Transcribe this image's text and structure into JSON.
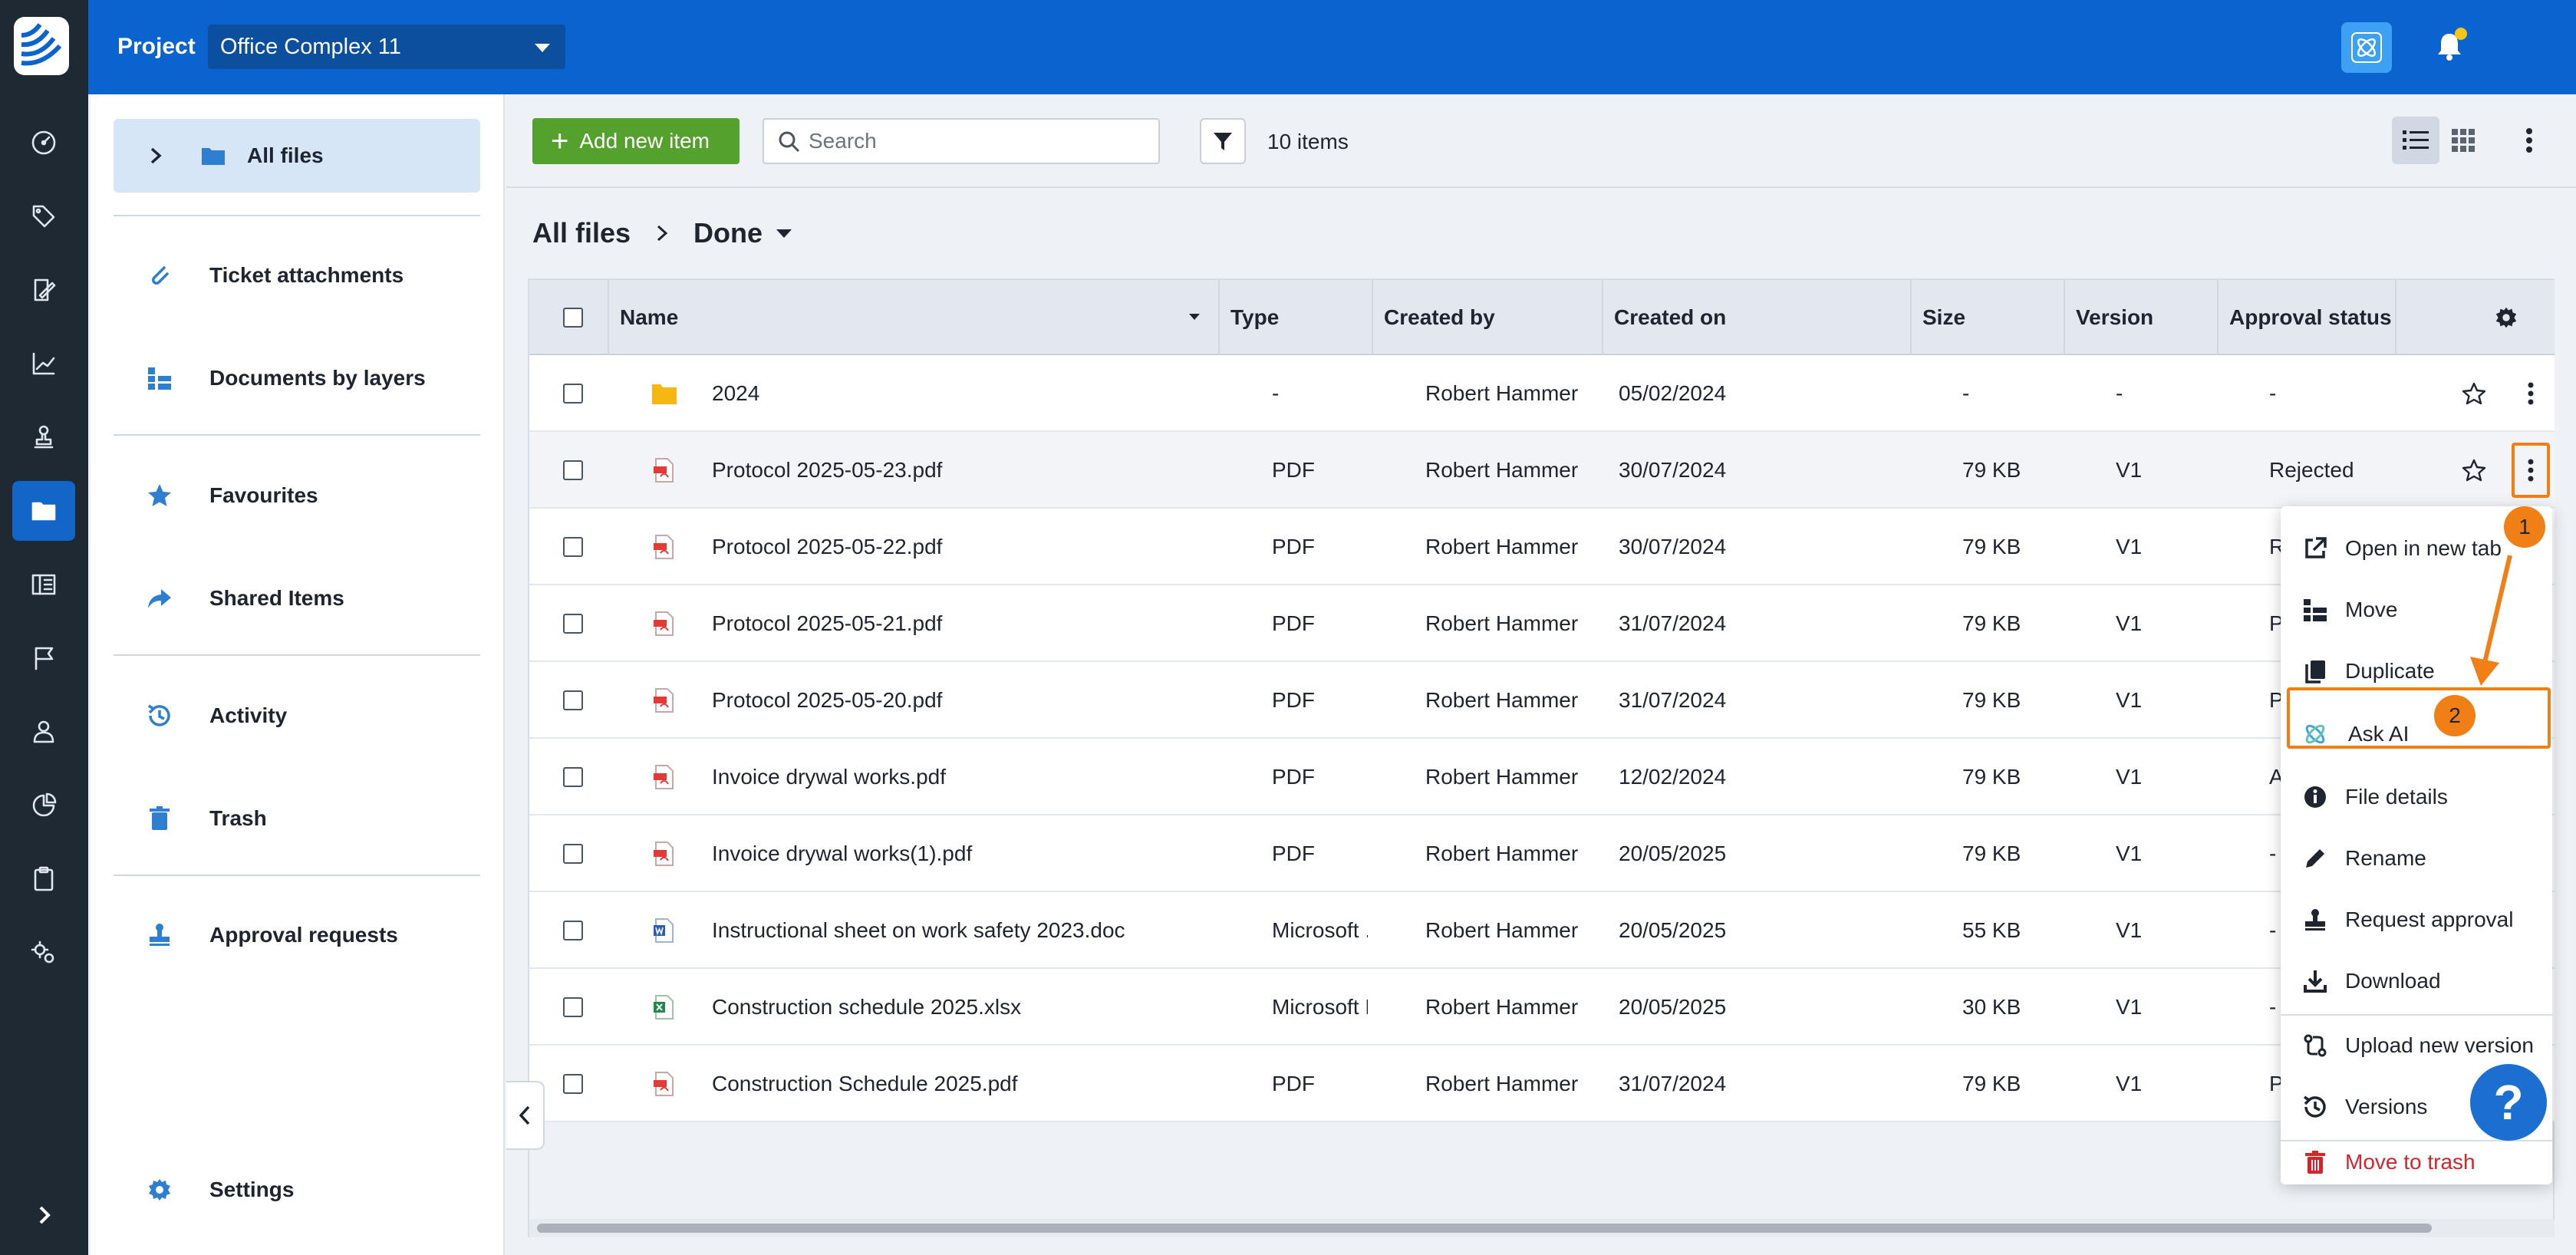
{
  "topbar": {
    "project_label": "Project",
    "project_value": "Office Complex 11"
  },
  "sidebar": {
    "items": [
      {
        "label": "All files",
        "icon": "folder-icon"
      },
      {
        "label": "Ticket attachments",
        "icon": "paperclip-icon"
      },
      {
        "label": "Documents by layers",
        "icon": "layers-icon"
      },
      {
        "label": "Favourites",
        "icon": "star-icon"
      },
      {
        "label": "Shared Items",
        "icon": "share-icon"
      },
      {
        "label": "Activity",
        "icon": "history-icon"
      },
      {
        "label": "Trash",
        "icon": "trash-icon"
      },
      {
        "label": "Approval requests",
        "icon": "stamp-icon"
      },
      {
        "label": "Settings",
        "icon": "gear-icon"
      }
    ]
  },
  "toolbar": {
    "add_label": "Add new item",
    "search_placeholder": "Search",
    "items_count": "10 items"
  },
  "breadcrumb": {
    "root": "All files",
    "current": "Done"
  },
  "table": {
    "columns": [
      "Name",
      "Type",
      "Created by",
      "Created on",
      "Size",
      "Version",
      "Approval status"
    ],
    "rows": [
      {
        "name": "2024",
        "type": "-",
        "created_by": "Robert Hammer",
        "created_on": "05/02/2024",
        "size": "-",
        "version": "-",
        "status": "-",
        "icon": "folder"
      },
      {
        "name": "Protocol 2025-05-23.pdf",
        "type": "PDF",
        "created_by": "Robert Hammer",
        "created_on": "30/07/2024",
        "size": "79 KB",
        "version": "V1",
        "status": "Rejected",
        "icon": "pdf"
      },
      {
        "name": "Protocol 2025-05-22.pdf",
        "type": "PDF",
        "created_by": "Robert Hammer",
        "created_on": "30/07/2024",
        "size": "79 KB",
        "version": "V1",
        "status": "Reje",
        "icon": "pdf"
      },
      {
        "name": "Protocol 2025-05-21.pdf",
        "type": "PDF",
        "created_by": "Robert Hammer",
        "created_on": "31/07/2024",
        "size": "79 KB",
        "version": "V1",
        "status": "Pen",
        "icon": "pdf"
      },
      {
        "name": "Protocol 2025-05-20.pdf",
        "type": "PDF",
        "created_by": "Robert Hammer",
        "created_on": "31/07/2024",
        "size": "79 KB",
        "version": "V1",
        "status": "Pen",
        "icon": "pdf"
      },
      {
        "name": "Invoice drywal works.pdf",
        "type": "PDF",
        "created_by": "Robert Hammer",
        "created_on": "12/02/2024",
        "size": "79 KB",
        "version": "V1",
        "status": "App",
        "icon": "pdf"
      },
      {
        "name": "Invoice drywal works(1).pdf",
        "type": "PDF",
        "created_by": "Robert Hammer",
        "created_on": "20/05/2025",
        "size": "79 KB",
        "version": "V1",
        "status": "-",
        "icon": "pdf"
      },
      {
        "name": "Instructional sheet on work safety 2023.doc",
        "type": "Microsoft ...",
        "created_by": "Robert Hammer",
        "created_on": "20/05/2025",
        "size": "55 KB",
        "version": "V1",
        "status": "-",
        "icon": "word"
      },
      {
        "name": "Construction schedule 2025.xlsx",
        "type": "Microsoft E...",
        "created_by": "Robert Hammer",
        "created_on": "20/05/2025",
        "size": "30 KB",
        "version": "V1",
        "status": "-",
        "icon": "excel"
      },
      {
        "name": "Construction Schedule 2025.pdf",
        "type": "PDF",
        "created_by": "Robert Hammer",
        "created_on": "31/07/2024",
        "size": "79 KB",
        "version": "V1",
        "status": "Pen",
        "icon": "pdf"
      }
    ]
  },
  "context_menu": {
    "items": [
      {
        "label": "Open in new tab",
        "icon": "external-link-icon"
      },
      {
        "label": "Move",
        "icon": "move-icon"
      },
      {
        "label": "Duplicate",
        "icon": "duplicate-icon"
      },
      {
        "label": "Ask AI",
        "icon": "ai-icon"
      },
      {
        "label": "File details",
        "icon": "info-icon"
      },
      {
        "label": "Rename",
        "icon": "pencil-icon"
      },
      {
        "label": "Request approval",
        "icon": "stamp-icon"
      },
      {
        "label": "Download",
        "icon": "download-icon"
      },
      {
        "label": "Upload new version",
        "icon": "upload-version-icon"
      },
      {
        "label": "Versions",
        "icon": "history-icon"
      },
      {
        "label": "Move to trash",
        "icon": "trash-icon"
      }
    ]
  },
  "annotations": {
    "step1": "1",
    "step2": "2"
  },
  "help_label": "?",
  "colors": {
    "brand_blue": "#0a63cf",
    "accent_green": "#54a12e",
    "highlight_orange": "#f07f16",
    "danger_red": "#d8232a"
  }
}
